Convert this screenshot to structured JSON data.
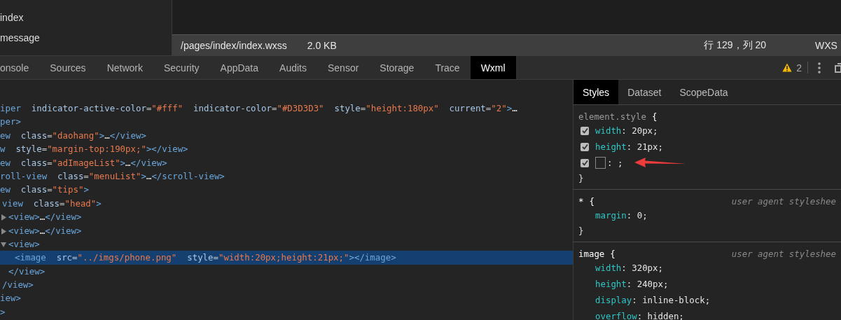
{
  "file_tree": {
    "items": [
      {
        "label": "index"
      },
      {
        "label": "message"
      }
    ]
  },
  "editor_status": {
    "path": "/pages/index/index.wxss",
    "size": "2.0 KB",
    "position": "行 129，列 20",
    "language": "WXS"
  },
  "tabs": [
    {
      "label": "onsole",
      "selected": false
    },
    {
      "label": "Sources",
      "selected": false
    },
    {
      "label": "Network",
      "selected": false
    },
    {
      "label": "Security",
      "selected": false
    },
    {
      "label": "AppData",
      "selected": false
    },
    {
      "label": "Audits",
      "selected": false
    },
    {
      "label": "Sensor",
      "selected": false
    },
    {
      "label": "Storage",
      "selected": false
    },
    {
      "label": "Trace",
      "selected": false
    },
    {
      "label": "Wxml",
      "selected": true
    }
  ],
  "warnings": {
    "count": "2"
  },
  "element_tree": [
    {
      "selected": false,
      "tokens": [
        {
          "kind": "tag",
          "text": "iper"
        },
        {
          "kind": "attr",
          "text": "  indicator-active-color"
        },
        {
          "kind": "punct",
          "text": "="
        },
        {
          "kind": "value",
          "text": "\"#fff\""
        },
        {
          "kind": "attr",
          "text": "  indicator-color"
        },
        {
          "kind": "punct",
          "text": "="
        },
        {
          "kind": "value",
          "text": "\"#D3D3D3\""
        },
        {
          "kind": "attr",
          "text": "  style"
        },
        {
          "kind": "punct",
          "text": "="
        },
        {
          "kind": "value",
          "text": "\"height:180px\""
        },
        {
          "kind": "attr",
          "text": "  current"
        },
        {
          "kind": "punct",
          "text": "="
        },
        {
          "kind": "value",
          "text": "\"2\""
        },
        {
          "kind": "tag",
          "text": ">"
        },
        {
          "kind": "dots",
          "text": "…"
        }
      ],
      "close": [
        {
          "kind": "tag",
          "text": "per>"
        }
      ]
    },
    {
      "selected": false,
      "tokens": [
        {
          "kind": "tag",
          "text": "ew"
        },
        {
          "kind": "attr",
          "text": "  class"
        },
        {
          "kind": "punct",
          "text": "="
        },
        {
          "kind": "value",
          "text": "\"daohang\""
        },
        {
          "kind": "tag",
          "text": ">"
        },
        {
          "kind": "dots",
          "text": "…"
        },
        {
          "kind": "tag",
          "text": "</view>"
        }
      ]
    },
    {
      "selected": false,
      "tokens": [
        {
          "kind": "tag",
          "text": "w"
        },
        {
          "kind": "attr",
          "text": "  style"
        },
        {
          "kind": "punct",
          "text": "="
        },
        {
          "kind": "value",
          "text": "\"margin-top:190px;\""
        },
        {
          "kind": "tag",
          "text": "></view>"
        }
      ]
    },
    {
      "selected": false,
      "tokens": [
        {
          "kind": "tag",
          "text": "ew"
        },
        {
          "kind": "attr",
          "text": "  class"
        },
        {
          "kind": "punct",
          "text": "="
        },
        {
          "kind": "value",
          "text": "\"adImageList\""
        },
        {
          "kind": "tag",
          "text": ">"
        },
        {
          "kind": "dots",
          "text": "…"
        },
        {
          "kind": "tag",
          "text": "</view>"
        }
      ]
    },
    {
      "selected": false,
      "tokens": [
        {
          "kind": "tag",
          "text": "roll-view"
        },
        {
          "kind": "attr",
          "text": "  class"
        },
        {
          "kind": "punct",
          "text": "="
        },
        {
          "kind": "value",
          "text": "\"menuList\""
        },
        {
          "kind": "tag",
          "text": ">"
        },
        {
          "kind": "dots",
          "text": "…"
        },
        {
          "kind": "tag",
          "text": "</scroll-view>"
        }
      ]
    },
    {
      "selected": false,
      "tokens": [
        {
          "kind": "tag",
          "text": "ew"
        },
        {
          "kind": "attr",
          "text": "  class"
        },
        {
          "kind": "punct",
          "text": "="
        },
        {
          "kind": "value",
          "text": "\"tips\""
        },
        {
          "kind": "tag",
          "text": ">"
        }
      ],
      "close": [
        {
          "kind": "tag",
          "text": "iew>"
        }
      ],
      "children": [
        {
          "selected": false,
          "tokens": [
            {
              "kind": "tag",
              "text": "view"
            },
            {
              "kind": "attr",
              "text": "  class"
            },
            {
              "kind": "punct",
              "text": "="
            },
            {
              "kind": "value",
              "text": "\"head\""
            },
            {
              "kind": "tag",
              "text": ">"
            }
          ],
          "close": [
            {
              "kind": "tag",
              "text": "/view>"
            }
          ],
          "children": [
            {
              "selected": false,
              "expanded": false,
              "tokens": [
                {
                  "kind": "tag",
                  "text": "<view>"
                },
                {
                  "kind": "dots",
                  "text": "…"
                },
                {
                  "kind": "tag",
                  "text": "</view>"
                }
              ]
            },
            {
              "selected": false,
              "expanded": false,
              "tokens": [
                {
                  "kind": "tag",
                  "text": "<view>"
                },
                {
                  "kind": "dots",
                  "text": "…"
                },
                {
                  "kind": "tag",
                  "text": "</view>"
                }
              ]
            },
            {
              "selected": false,
              "expanded": true,
              "tokens": [
                {
                  "kind": "tag",
                  "text": "<view>"
                }
              ],
              "close": [
                {
                  "kind": "tag",
                  "text": "</view>"
                }
              ],
              "children": [
                {
                  "selected": true,
                  "tokens": [
                    {
                      "kind": "tag",
                      "text": "<image"
                    },
                    {
                      "kind": "attr",
                      "text": "  src"
                    },
                    {
                      "kind": "punct",
                      "text": "="
                    },
                    {
                      "kind": "value",
                      "text": "\"../imgs/phone.png\""
                    },
                    {
                      "kind": "attr",
                      "text": "  style"
                    },
                    {
                      "kind": "punct",
                      "text": "="
                    },
                    {
                      "kind": "value",
                      "text": "\"width:20px;height:21px;\""
                    },
                    {
                      "kind": "tag",
                      "text": "></image>"
                    }
                  ]
                }
              ]
            }
          ]
        }
      ]
    },
    {
      "selected": false,
      "tokens": [
        {
          "kind": "tag",
          "text": ">"
        }
      ]
    }
  ],
  "styles_panel": {
    "tabs": [
      {
        "label": "Styles",
        "selected": true
      },
      {
        "label": "Dataset",
        "selected": false
      },
      {
        "label": "ScopeData",
        "selected": false
      }
    ],
    "rules": [
      {
        "kind": "inline",
        "selector": "element.style",
        "open": "{",
        "close": "}",
        "properties": [
          {
            "kind": "prop",
            "name": "width",
            "value": ": 20px;",
            "checked": true
          },
          {
            "kind": "prop",
            "name": "height",
            "value": ": 21px;",
            "checked": true
          },
          {
            "kind": "blank",
            "text": ": ;",
            "checked": true
          }
        ]
      },
      {
        "kind": "user-agent",
        "selector": "*",
        "open": "{",
        "close": "}",
        "source": "user agent styleshee",
        "properties": [
          {
            "kind": "prop",
            "name": "margin",
            "value": ": 0;"
          }
        ]
      },
      {
        "kind": "user-agent",
        "selector": "image",
        "open": "{",
        "source": "user agent styleshee",
        "properties": [
          {
            "kind": "prop",
            "name": "width",
            "value": ": 320px;"
          },
          {
            "kind": "prop",
            "name": "height",
            "value": ": 240px;"
          },
          {
            "kind": "prop",
            "name": "display",
            "value": ": inline-block;"
          },
          {
            "kind": "prop",
            "name": "overflow",
            "value": ": hidden;"
          }
        ]
      }
    ]
  }
}
